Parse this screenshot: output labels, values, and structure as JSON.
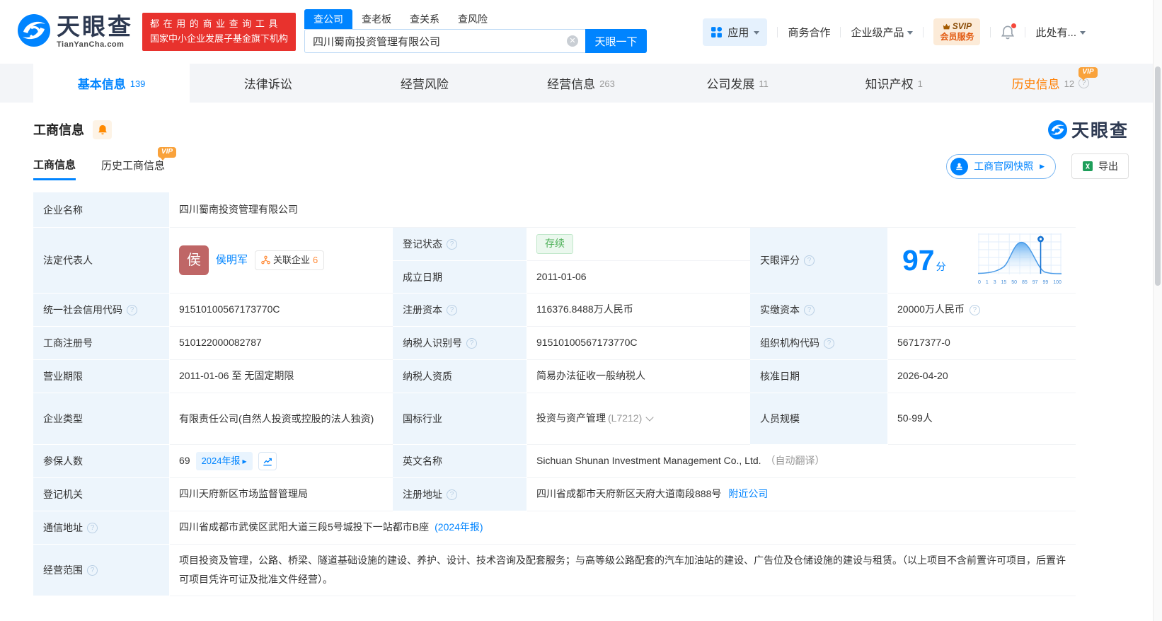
{
  "accent": "#0084ff",
  "vip_tag": "VIP",
  "header": {
    "logo_title": "天眼查",
    "logo_domain": "TianYanCha.com",
    "slogan_line1": "都 在 用 的 商 业 查 询 工 具",
    "slogan_line2": "国家中小企业发展子基金旗下机构",
    "search_tabs": [
      {
        "label": "查公司"
      },
      {
        "label": "查老板"
      },
      {
        "label": "查关系"
      },
      {
        "label": "查风险"
      }
    ],
    "search_value": "四川蜀南投资管理有限公司",
    "search_button": "天眼一下",
    "nav_apps": "应用",
    "nav_coop": "商务合作",
    "nav_enterprise": "企业级产品",
    "svip_top": "SVIP",
    "svip_bottom": "会员服务",
    "nav_more": "此处有..."
  },
  "tabs": [
    {
      "label": "基本信息",
      "count": "139"
    },
    {
      "label": "法律诉讼",
      "count": ""
    },
    {
      "label": "经营风险",
      "count": ""
    },
    {
      "label": "经营信息",
      "count": "263"
    },
    {
      "label": "公司发展",
      "count": "11"
    },
    {
      "label": "知识产权",
      "count": "1"
    },
    {
      "label": "历史信息",
      "count": "12"
    }
  ],
  "section": {
    "title": "工商信息",
    "watermark": "天眼查",
    "subtab_current": "工商信息",
    "subtab_history": "历史工商信息",
    "snapshot_button": "工商官网快照",
    "export_button": "导出"
  },
  "info": {
    "company_name_label": "企业名称",
    "company_name": "四川蜀南投资管理有限公司",
    "legal_rep_label": "法定代表人",
    "legal_rep_avatar": "侯",
    "legal_rep_name": "侯明军",
    "related_companies_label": "关联企业",
    "related_companies_count": "6",
    "reg_status_label": "登记状态",
    "reg_status_value": "存续",
    "establish_date_label": "成立日期",
    "establish_date_value": "2011-01-06",
    "score_label": "天眼评分",
    "score_value": "97",
    "score_unit": "分",
    "credit_code_label": "统一社会信用代码",
    "credit_code_value": "91510100567173770C",
    "reg_capital_label": "注册资本",
    "reg_capital_value": "116376.8488万人民币",
    "paid_capital_label": "实缴资本",
    "paid_capital_value": "20000万人民币",
    "reg_number_label": "工商注册号",
    "reg_number_value": "510122000082787",
    "taxpayer_id_label": "纳税人识别号",
    "taxpayer_id_value": "91510100567173770C",
    "org_code_label": "组织机构代码",
    "org_code_value": "56717377-0",
    "business_term_label": "营业期限",
    "business_term_value": "2011-01-06 至 无固定期限",
    "taxpayer_quality_label": "纳税人资质",
    "taxpayer_quality_value": "简易办法征收一般纳税人",
    "approval_date_label": "核准日期",
    "approval_date_value": "2026-04-20",
    "company_type_label": "企业类型",
    "company_type_value": "有限责任公司(自然人投资或控股的法人独资)",
    "industry_label": "国标行业",
    "industry_value": "投资与资产管理",
    "industry_code": "(L7212)",
    "staff_size_label": "人员规模",
    "staff_size_value": "50-99人",
    "insured_label": "参保人数",
    "insured_value": "69",
    "insured_badge": "2024年报",
    "english_name_label": "英文名称",
    "english_name_value": "Sichuan Shunan Investment Management Co., Ltd.",
    "english_name_note": "（自动翻译）",
    "reg_authority_label": "登记机关",
    "reg_authority_value": "四川天府新区市场监督管理局",
    "reg_address_label": "注册地址",
    "reg_address_value": "四川省成都市天府新区天府大道南段888号",
    "reg_address_link": "附近公司",
    "mail_address_label": "通信地址",
    "mail_address_value": "四川省成都市武侯区武阳大道三段5号城投下一站都市B座",
    "mail_address_link": "(2024年报)",
    "business_scope_label": "经营范围",
    "business_scope_value": "项目投资及管理，公路、桥梁、隧道基础设施的建设、养护、设计、技术咨询及配套服务；与高等级公路配套的汽车加油站的建设、广告位及仓储设施的建设与租赁。（以上项目不含前置许可项目，后置许可项目凭许可证及批准文件经营）。"
  },
  "chart_data": {
    "type": "area",
    "title": "天眼评分分布曲线",
    "score": 97,
    "x_ticks": [
      "0",
      "1",
      "3",
      "15",
      "50",
      "85",
      "97",
      "99",
      "100"
    ],
    "marker_tick": "97",
    "legend_position": "none",
    "grid": true
  }
}
